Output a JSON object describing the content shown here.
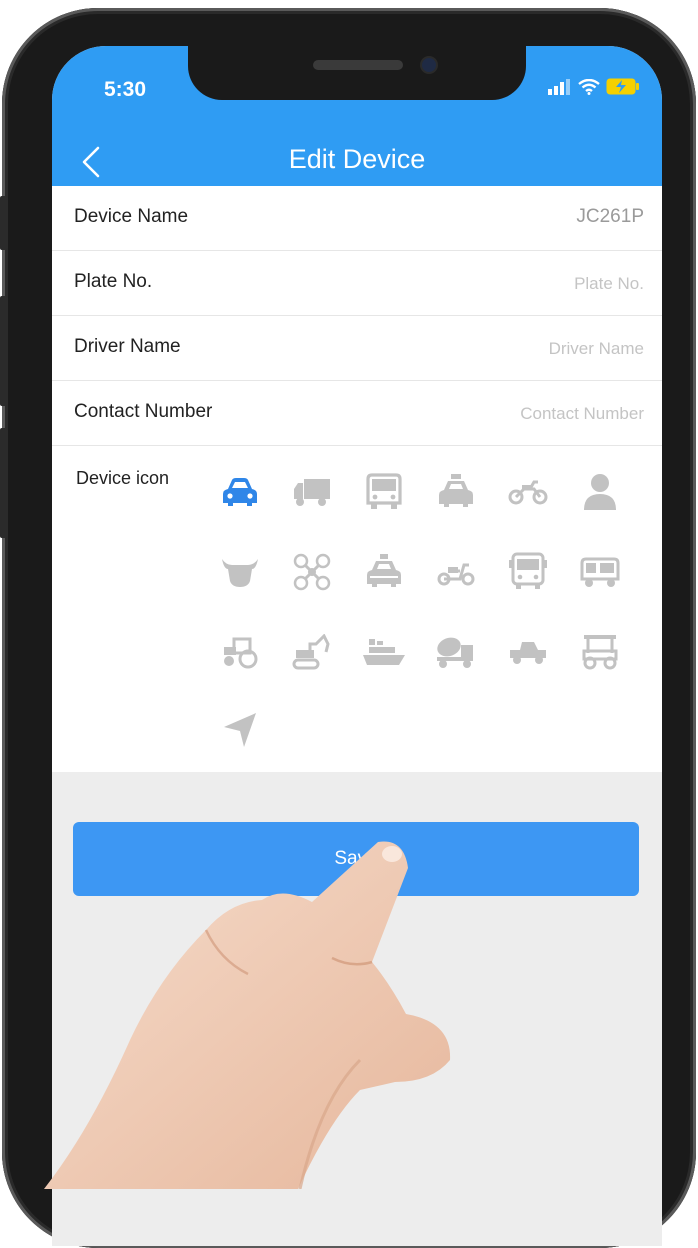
{
  "status_bar": {
    "time": "5:30"
  },
  "nav": {
    "title": "Edit Device"
  },
  "form": {
    "device_name": {
      "label": "Device Name",
      "value": "JC261P"
    },
    "plate_no": {
      "label": "Plate No.",
      "placeholder": "Plate No."
    },
    "driver_name": {
      "label": "Driver Name",
      "placeholder": "Driver Name"
    },
    "contact_number": {
      "label": "Contact Number",
      "placeholder": "Contact Number"
    }
  },
  "device_icon": {
    "label": "Device icon",
    "selected": "car",
    "icons": [
      "car",
      "truck",
      "bus",
      "taxi",
      "motorcycle",
      "person",
      "cattle",
      "drone",
      "police-car",
      "scooter",
      "coach-bus",
      "tuk-tuk",
      "tractor",
      "excavator",
      "ship",
      "mixer-truck",
      "pickup",
      "golf-cart",
      "arrow"
    ]
  },
  "save_button": {
    "label": "Save"
  },
  "colors": {
    "header": "#2f9cf3",
    "selected_icon": "#2f86e8",
    "icon": "#bdbdbd",
    "button": "#3d97f3"
  }
}
